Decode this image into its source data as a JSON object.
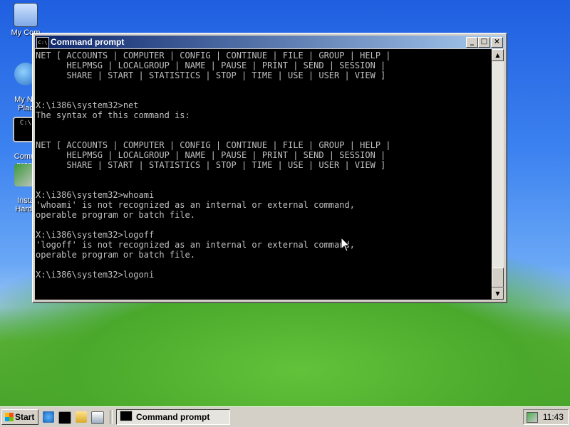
{
  "desktop": {
    "icons": [
      {
        "label": "My Com"
      },
      {
        "label": "My Ne\nPlac"
      },
      {
        "label": "Comm\nprom"
      },
      {
        "label": "Insta\nHardv"
      }
    ]
  },
  "window": {
    "title": "Command prompt",
    "icon_text": "C:\\",
    "buttons": {
      "minimize": "_",
      "maximize": "□",
      "close": "×"
    },
    "console_text": "NET [ ACCOUNTS | COMPUTER | CONFIG | CONTINUE | FILE | GROUP | HELP |\n      HELPMSG | LOCALGROUP | NAME | PAUSE | PRINT | SEND | SESSION |\n      SHARE | START | STATISTICS | STOP | TIME | USE | USER | VIEW ]\n\n\nX:\\i386\\system32>net\nThe syntax of this command is:\n\n\nNET [ ACCOUNTS | COMPUTER | CONFIG | CONTINUE | FILE | GROUP | HELP |\n      HELPMSG | LOCALGROUP | NAME | PAUSE | PRINT | SEND | SESSION |\n      SHARE | START | STATISTICS | STOP | TIME | USE | USER | VIEW ]\n\n\nX:\\i386\\system32>whoami\n'whoami' is not recognized as an internal or external command,\noperable program or batch file.\n\nX:\\i386\\system32>logoff\n'logoff' is not recognized as an internal or external command,\noperable program or batch file.\n\nX:\\i386\\system32>logoni"
  },
  "taskbar": {
    "start_label": "Start",
    "quick_launch": [
      "ie-icon",
      "cmd-icon",
      "folder-icon",
      "show-desktop-icon"
    ],
    "task_button_label": "Command prompt",
    "clock": "11:43"
  }
}
